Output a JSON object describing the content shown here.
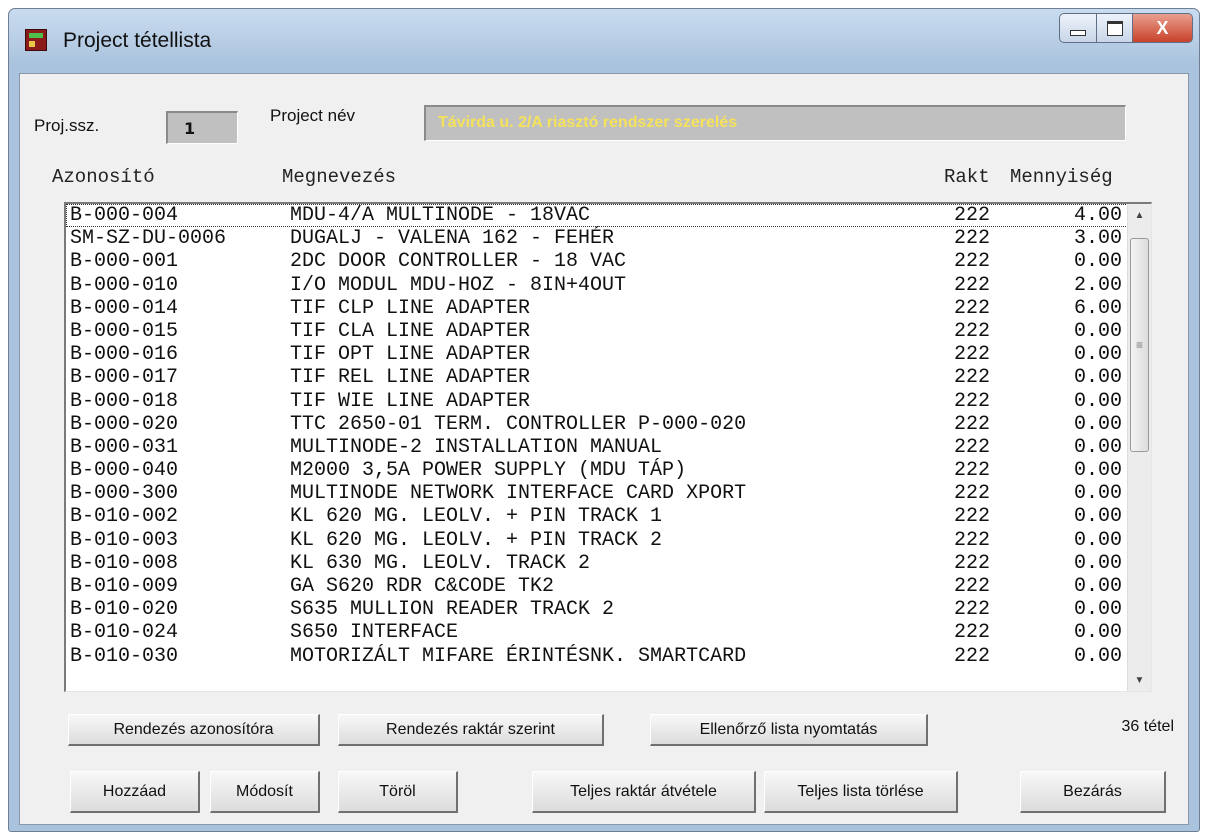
{
  "window": {
    "title": "Project tétellista",
    "close_glyph": "X"
  },
  "project": {
    "num_label": "Proj.ssz.",
    "num_value": "1",
    "name_label": "Project név",
    "name_value": "Távirda u. 2/A riasztó rendszer szerelés"
  },
  "columns": {
    "id": "Azonosító",
    "name": "Megnevezés",
    "rakt": "Rakt",
    "qty": "Mennyiség"
  },
  "items": [
    {
      "id": "B-000-004",
      "name": "MDU-4/A MULTINODE - 18VAC",
      "rakt": "222",
      "qty": "4.00"
    },
    {
      "id": "SM-SZ-DU-0006",
      "name": "DUGALJ - VALENA 162 - FEHÉR",
      "rakt": "222",
      "qty": "3.00"
    },
    {
      "id": "B-000-001",
      "name": "2DC DOOR CONTROLLER - 18 VAC",
      "rakt": "222",
      "qty": "0.00"
    },
    {
      "id": "B-000-010",
      "name": "I/O MODUL MDU-HOZ -  8IN+4OUT",
      "rakt": "222",
      "qty": "2.00"
    },
    {
      "id": "B-000-014",
      "name": "TIF CLP LINE ADAPTER",
      "rakt": "222",
      "qty": "6.00"
    },
    {
      "id": "B-000-015",
      "name": "TIF CLA LINE ADAPTER",
      "rakt": "222",
      "qty": "0.00"
    },
    {
      "id": "B-000-016",
      "name": "TIF OPT LINE ADAPTER",
      "rakt": "222",
      "qty": "0.00"
    },
    {
      "id": "B-000-017",
      "name": "TIF REL LINE ADAPTER",
      "rakt": "222",
      "qty": "0.00"
    },
    {
      "id": "B-000-018",
      "name": "TIF WIE LINE ADAPTER",
      "rakt": "222",
      "qty": "0.00"
    },
    {
      "id": "B-000-020",
      "name": "TTC 2650-01 TERM. CONTROLLER P-000-020",
      "rakt": "222",
      "qty": "0.00"
    },
    {
      "id": "B-000-031",
      "name": "MULTINODE-2 INSTALLATION MANUAL",
      "rakt": "222",
      "qty": "0.00"
    },
    {
      "id": "B-000-040",
      "name": "M2000 3,5A POWER SUPPLY (MDU TÁP)",
      "rakt": "222",
      "qty": "0.00"
    },
    {
      "id": "B-000-300",
      "name": "MULTINODE NETWORK INTERFACE CARD XPORT",
      "rakt": "222",
      "qty": "0.00"
    },
    {
      "id": "B-010-002",
      "name": "KL 620 MG. LEOLV. + PIN TRACK 1",
      "rakt": "222",
      "qty": "0.00"
    },
    {
      "id": "B-010-003",
      "name": "KL 620 MG. LEOLV. + PIN TRACK 2",
      "rakt": "222",
      "qty": "0.00"
    },
    {
      "id": "B-010-008",
      "name": "KL 630 MG. LEOLV. TRACK 2",
      "rakt": "222",
      "qty": "0.00"
    },
    {
      "id": "B-010-009",
      "name": "GA S620 RDR C&CODE TK2",
      "rakt": "222",
      "qty": "0.00"
    },
    {
      "id": "B-010-020",
      "name": "S635 MULLION READER TRACK 2",
      "rakt": "222",
      "qty": "0.00"
    },
    {
      "id": "B-010-024",
      "name": "S650 INTERFACE",
      "rakt": "222",
      "qty": "0.00"
    },
    {
      "id": "B-010-030",
      "name": "MOTORIZÁLT MIFARE ÉRINTÉSNK. SMARTCARD",
      "rakt": "222",
      "qty": "0.00"
    }
  ],
  "buttons": {
    "sort_id": "Rendezés azonosítóra",
    "sort_stock": "Rendezés raktár szerint",
    "print_check": "Ellenőrző lista nyomtatás",
    "add": "Hozzáad",
    "modify": "Módosít",
    "delete": "Töröl",
    "take_stock": "Teljes raktár átvétele",
    "clear_list": "Teljes lista törlése",
    "close": "Bezárás"
  },
  "count_text": "36 tétel"
}
